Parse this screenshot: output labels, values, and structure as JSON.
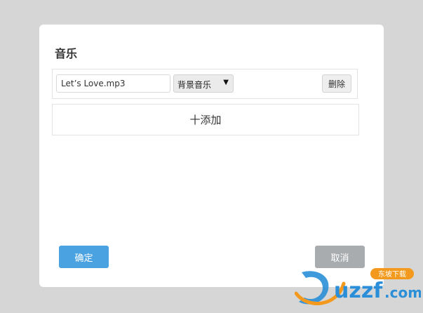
{
  "dialog": {
    "title": "音乐",
    "music_items": [
      {
        "filename": "Let’s Love.mp3",
        "type": "背景音乐",
        "delete_label": "删除"
      }
    ],
    "add_label": "十添加",
    "confirm_label": "确定",
    "cancel_label": "取消"
  },
  "watermark": {
    "brand": "uzzf.com",
    "tagline": "东坡下载"
  },
  "colors": {
    "confirm": "#4aa3e0",
    "cancel": "#a9acaf",
    "backdrop": "#d6d6d6"
  }
}
